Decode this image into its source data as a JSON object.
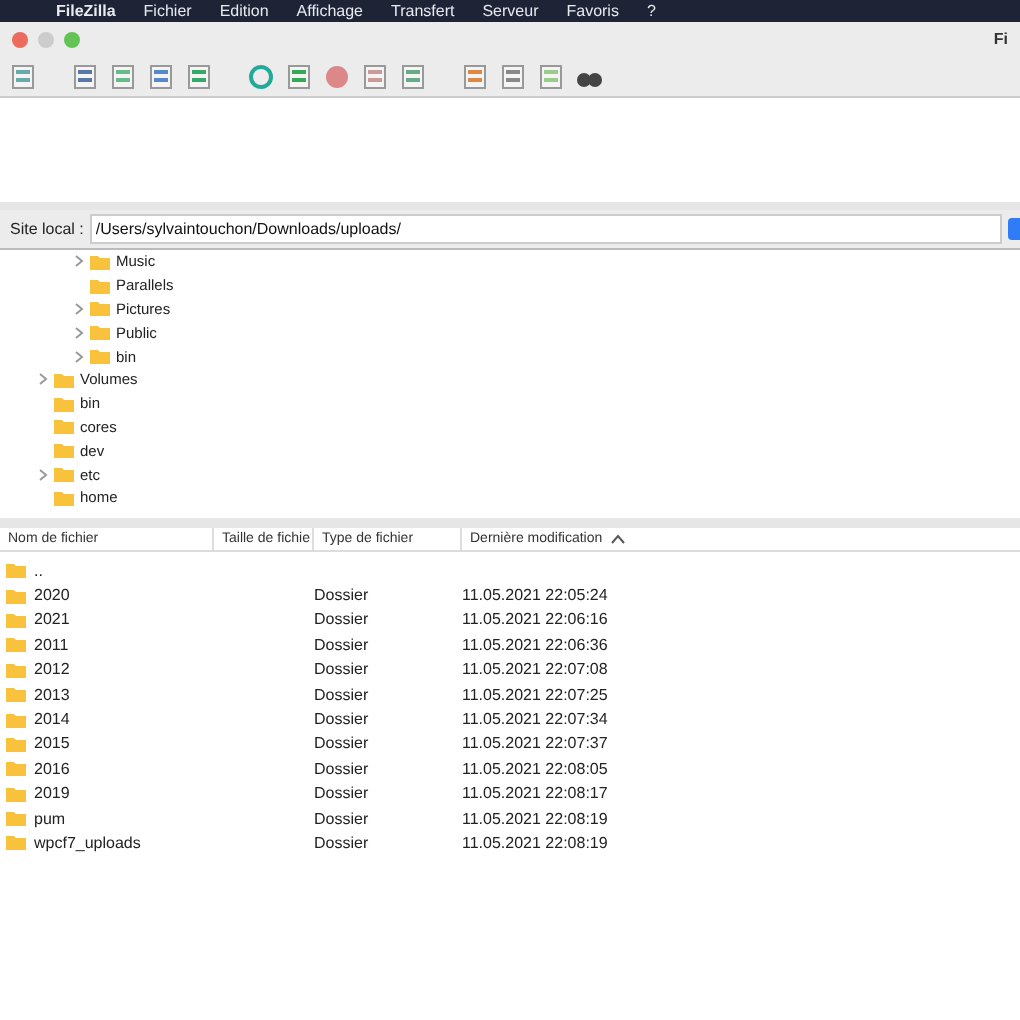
{
  "menu_bar": [
    "FileZilla",
    "Fichier",
    "Edition",
    "Affichage",
    "Transfert",
    "Serveur",
    "Favoris",
    "?"
  ],
  "window": {
    "title": "Fi"
  },
  "site_local": {
    "label": "Site local :",
    "value": "/Users/sylvaintouchon/Downloads/uploads/"
  },
  "tree": {
    "nested_items": [
      {
        "name": "Music",
        "expandable": true
      },
      {
        "name": "Parallels",
        "expandable": false
      },
      {
        "name": "Pictures",
        "expandable": true
      },
      {
        "name": "Public",
        "expandable": true
      },
      {
        "name": "bin",
        "expandable": true
      }
    ],
    "items": [
      {
        "name": "Volumes",
        "expandable": true
      },
      {
        "name": "bin",
        "expandable": false
      },
      {
        "name": "cores",
        "expandable": false
      },
      {
        "name": "dev",
        "expandable": false
      },
      {
        "name": "etc",
        "expandable": true
      },
      {
        "name": "home",
        "expandable": false
      }
    ]
  },
  "file_list": {
    "columns": [
      {
        "label": "Nom de fichier",
        "sorted": false
      },
      {
        "label": "Taille de fichie",
        "sorted": false
      },
      {
        "label": "Type de fichier",
        "sorted": false
      },
      {
        "label": "Dernière modification",
        "sorted": true
      }
    ],
    "rows": [
      {
        "name": "..",
        "type": "",
        "modified": ""
      },
      {
        "name": "2020",
        "type": "Dossier",
        "modified": "11.05.2021 22:05:24"
      },
      {
        "name": "2021",
        "type": "Dossier",
        "modified": "11.05.2021 22:06:16"
      },
      {
        "name": "2011",
        "type": "Dossier",
        "modified": "11.05.2021 22:06:36"
      },
      {
        "name": "2012",
        "type": "Dossier",
        "modified": "11.05.2021 22:07:08"
      },
      {
        "name": "2013",
        "type": "Dossier",
        "modified": "11.05.2021 22:07:25"
      },
      {
        "name": "2014",
        "type": "Dossier",
        "modified": "11.05.2021 22:07:34"
      },
      {
        "name": "2015",
        "type": "Dossier",
        "modified": "11.05.2021 22:07:37"
      },
      {
        "name": "2016",
        "type": "Dossier",
        "modified": "11.05.2021 22:08:05"
      },
      {
        "name": "2019",
        "type": "Dossier",
        "modified": "11.05.2021 22:08:17"
      },
      {
        "name": "pum",
        "type": "Dossier",
        "modified": "11.05.2021 22:08:19"
      },
      {
        "name": "wpcf7_uploads",
        "type": "Dossier",
        "modified": "11.05.2021 22:08:19"
      }
    ]
  }
}
